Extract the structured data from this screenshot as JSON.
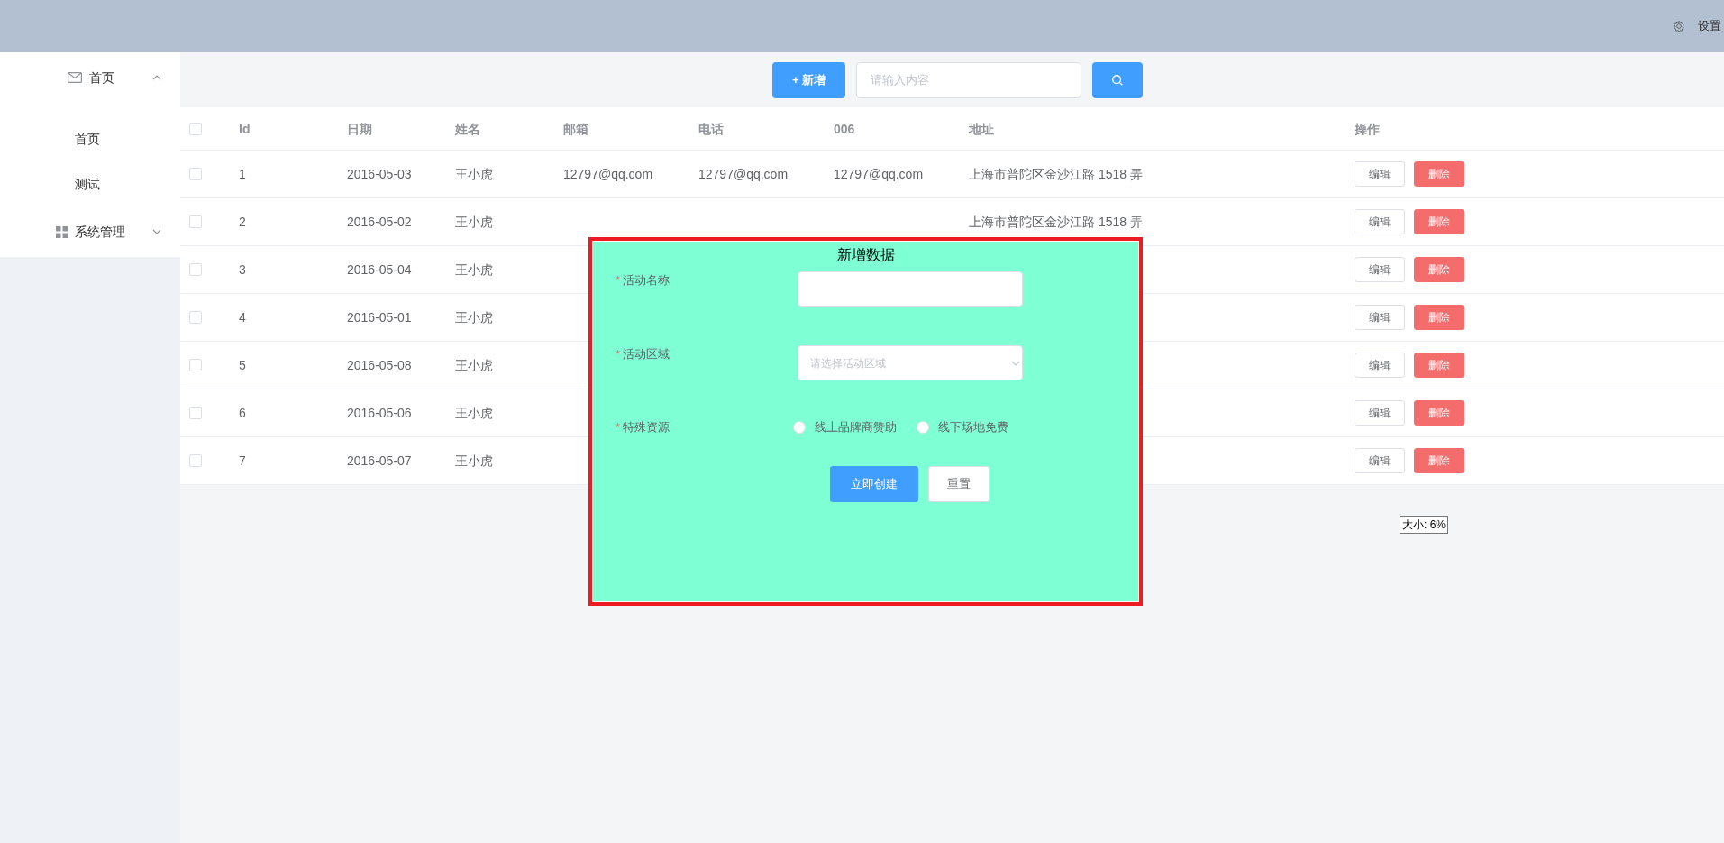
{
  "header": {
    "settings": "设置"
  },
  "sidebar": {
    "items": [
      {
        "label": "首页",
        "kind": "mail",
        "expanded": true,
        "children": [
          {
            "label": "首页"
          },
          {
            "label": "测试"
          }
        ]
      },
      {
        "label": "系统管理",
        "kind": "grid",
        "expanded": false
      }
    ]
  },
  "toolbar": {
    "add_button": "+ 新增",
    "search": {
      "placeholder": "请输入内容"
    }
  },
  "table": {
    "select_all": {
      "checked": false
    },
    "columns": [
      "Id",
      "日期",
      "姓名",
      "邮箱",
      "电话",
      "006",
      "地址",
      "操作"
    ],
    "rows": [
      {
        "checked": false,
        "id": "1",
        "date": "2016-05-03",
        "name": "王小虎",
        "email": "12797@qq.com",
        "phone": "12797@qq.com",
        "col_006": "12797@qq.com",
        "address": "上海市普陀区金沙江路 1518 弄",
        "actions": [
          "编辑",
          "删除"
        ]
      },
      {
        "checked": false,
        "id": "2",
        "date": "2016-05-02",
        "name": "王小虎",
        "address": "上海市普陀区金沙江路 1518 弄",
        "actions": [
          "编辑",
          "删除"
        ]
      },
      {
        "checked": false,
        "id": "3",
        "date": "2016-05-04",
        "name": "王小虎",
        "actions": [
          "编辑",
          "删除"
        ]
      },
      {
        "checked": false,
        "id": "4",
        "date": "2016-05-01",
        "name": "王小虎",
        "actions": [
          "编辑",
          "删除"
        ]
      },
      {
        "checked": false,
        "id": "5",
        "date": "2016-05-08",
        "name": "王小虎",
        "actions": [
          "编辑",
          "删除"
        ]
      },
      {
        "checked": false,
        "id": "6",
        "date": "2016-05-06",
        "name": "王小虎",
        "actions": [
          "编辑",
          "删除"
        ]
      },
      {
        "checked": false,
        "id": "7",
        "date": "2016-05-07",
        "name": "王小虎",
        "actions": [
          "编辑",
          "删除"
        ]
      }
    ]
  },
  "dialog": {
    "title": "新增数据",
    "fields": [
      {
        "kind": "input",
        "label": "活动名称",
        "required_mark": "*"
      },
      {
        "kind": "select",
        "label": "活动区域",
        "required_mark": "*",
        "placeholder": "请选择活动区域"
      },
      {
        "kind": "radio",
        "label": "特殊资源",
        "required_mark": "*",
        "options": [
          {
            "label": "线上品牌商赞助",
            "selected": false
          },
          {
            "label": "线下场地免费",
            "selected": false
          }
        ]
      }
    ],
    "buttons": [
      {
        "kind": "primary",
        "label": "立即创建"
      },
      {
        "kind": "default",
        "label": "重置"
      }
    ]
  },
  "tooltip": "大小: 6%"
}
